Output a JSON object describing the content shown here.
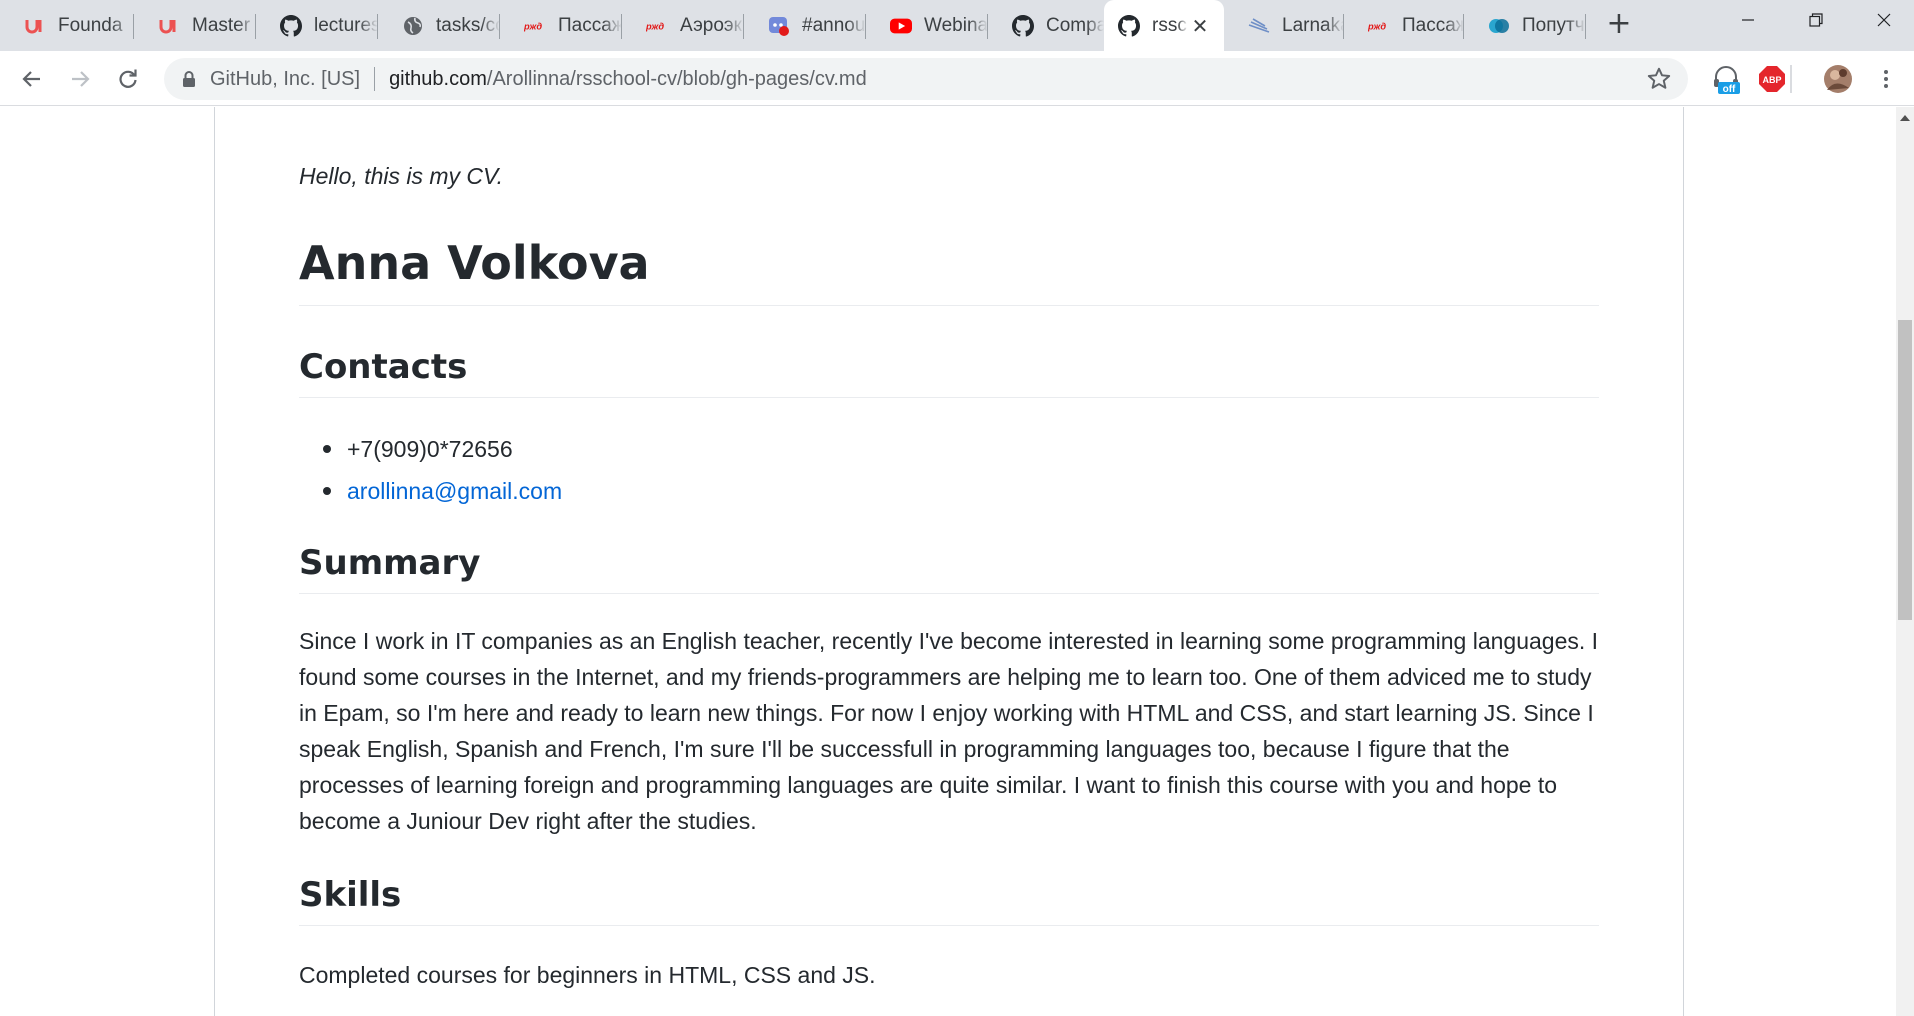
{
  "tabs": [
    {
      "title": "Founda",
      "icon": "udemy-icon"
    },
    {
      "title": "Master",
      "icon": "udemy-icon"
    },
    {
      "title": "lectures",
      "icon": "github-icon"
    },
    {
      "title": "tasks/cc",
      "icon": "globe-icon"
    },
    {
      "title": "Пассаж",
      "icon": "rzd-icon"
    },
    {
      "title": "Аэроэкс",
      "icon": "rzd-icon"
    },
    {
      "title": "#annou",
      "icon": "discord-icon"
    },
    {
      "title": "Webina",
      "icon": "youtube-icon"
    },
    {
      "title": "Compa",
      "icon": "github-icon"
    },
    {
      "title": "rssc",
      "icon": "github-icon",
      "active": true
    },
    {
      "title": "Larnaka",
      "icon": "plane-icon"
    },
    {
      "title": "Пассаж",
      "icon": "rzd-icon"
    },
    {
      "title": "Попутч",
      "icon": "blablacar-icon"
    }
  ],
  "toolbar": {
    "site_identity": "GitHub, Inc. [US]",
    "url_host": "github.com",
    "url_path": "/Arollinna/rsschool-cv/blob/gh-pages/cv.md",
    "ext_label_off": "off",
    "ext_label_abp": "ABP"
  },
  "colors": {
    "link": "#0366d6",
    "text": "#24292e",
    "tabstrip": "#dee1e6",
    "abp_red": "#e4262c",
    "ext_blue": "#1a9ee6"
  },
  "document": {
    "intro": "Hello, this is my CV.",
    "name": "Anna Volkova",
    "contacts_heading": "Contacts",
    "contacts": [
      "+7(909)0*72656",
      "arollinna@gmail.com"
    ],
    "summary_heading": "Summary",
    "summary": "Since I work in IT companies as an English teacher, recently I've become interested in learning some programming languages. I found some courses in the Internet, and my friends-programmers are helping me to learn too. One of them adviced me to study in Epam, so I'm here and ready to learn new things. For now I enjoy working with HTML and CSS, and start learning JS. Since I speak English, Spanish and French, I'm sure I'll be successfull in programming languages too, because I figure that the processes of learning foreign and programming languages are quite similar. I want to finish this course with you and hope to become a Juniour Dev right after the studies.",
    "skills_heading": "Skills",
    "skills": "Completed courses for beginners in HTML, CSS and JS."
  }
}
